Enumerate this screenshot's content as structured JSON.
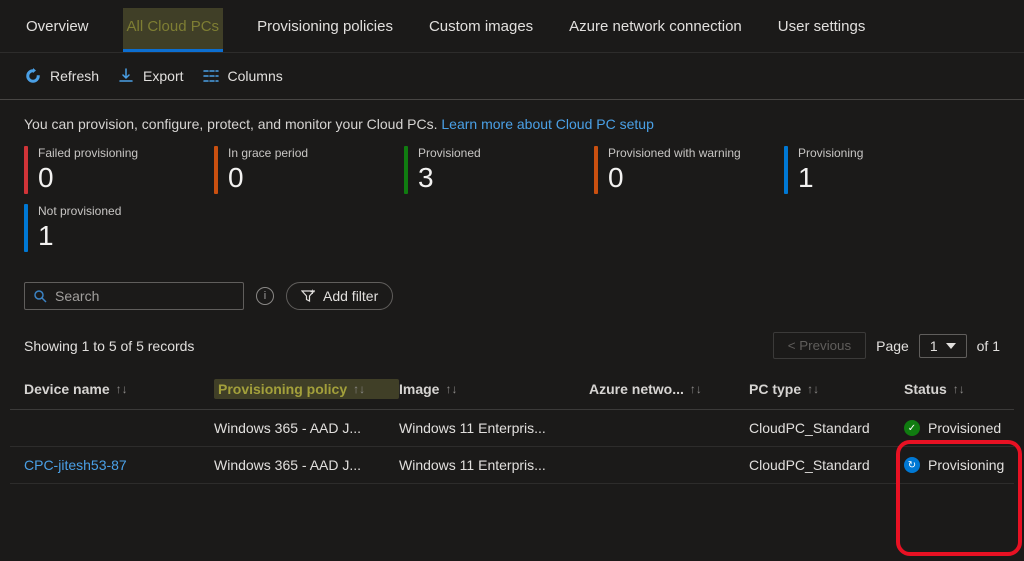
{
  "tabs": [
    "Overview",
    "All Cloud PCs",
    "Provisioning policies",
    "Custom images",
    "Azure network connection",
    "User settings"
  ],
  "active_tab_index": 1,
  "toolbar": {
    "refresh": "Refresh",
    "export": "Export",
    "columns": "Columns"
  },
  "intro": {
    "text": "You can provision, configure, protect, and monitor your Cloud PCs.",
    "link": "Learn more about Cloud PC setup"
  },
  "stats": [
    {
      "label": "Failed provisioning",
      "value": "0",
      "color": "#d13438"
    },
    {
      "label": "In grace period",
      "value": "0",
      "color": "#ca5010"
    },
    {
      "label": "Provisioned",
      "value": "3",
      "color": "#107c10"
    },
    {
      "label": "Provisioned with warning",
      "value": "0",
      "color": "#ca5010"
    },
    {
      "label": "Provisioning",
      "value": "1",
      "color": "#0078d4"
    },
    {
      "label": "Not provisioned",
      "value": "1",
      "color": "#0078d4"
    }
  ],
  "search_placeholder": "Search",
  "add_filter": "Add filter",
  "records_text": "Showing 1 to 5 of 5 records",
  "pager": {
    "prev": "< Previous",
    "page_label": "Page",
    "page_value": "1",
    "of_text": "of 1"
  },
  "columns": [
    "Device name",
    "Provisioning policy",
    "Image",
    "Azure netwo...",
    "PC type",
    "Status"
  ],
  "highlight_column_index": 1,
  "rows": [
    {
      "device": "",
      "policy": "Windows 365 - AAD J...",
      "image": "Windows 11 Enterpris...",
      "network": "",
      "pctype": "CloudPC_Standard",
      "status": "Provisioned",
      "status_kind": "green"
    },
    {
      "device": "CPC-jitesh53-87",
      "policy": "Windows 365 - AAD J...",
      "image": "Windows 11 Enterpris...",
      "network": "",
      "pctype": "CloudPC_Standard",
      "status": "Provisioning",
      "status_kind": "blue"
    }
  ]
}
